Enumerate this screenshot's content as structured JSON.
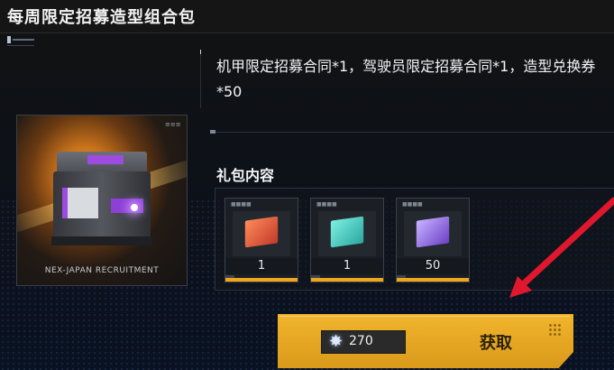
{
  "title": "每周限定招募造型组合包",
  "description": "机甲限定招募合同*1，驾驶员限定招募合同*1，造型兑换券*50",
  "image_caption": "NEX-JAPAN RECRUITMENT",
  "contents_title": "礼包内容",
  "items": [
    {
      "name": "mech-contract",
      "qty": "1",
      "color": "#e8553a"
    },
    {
      "name": "pilot-contract",
      "qty": "1",
      "color": "#43d3c6"
    },
    {
      "name": "style-voucher",
      "qty": "50",
      "color": "#8a5ad8"
    }
  ],
  "purchase": {
    "price": "270",
    "currency_icon": "crystal-icon",
    "button_label": "获取"
  },
  "colors": {
    "accent": "#f0a61a",
    "arrow": "#e0182d"
  }
}
